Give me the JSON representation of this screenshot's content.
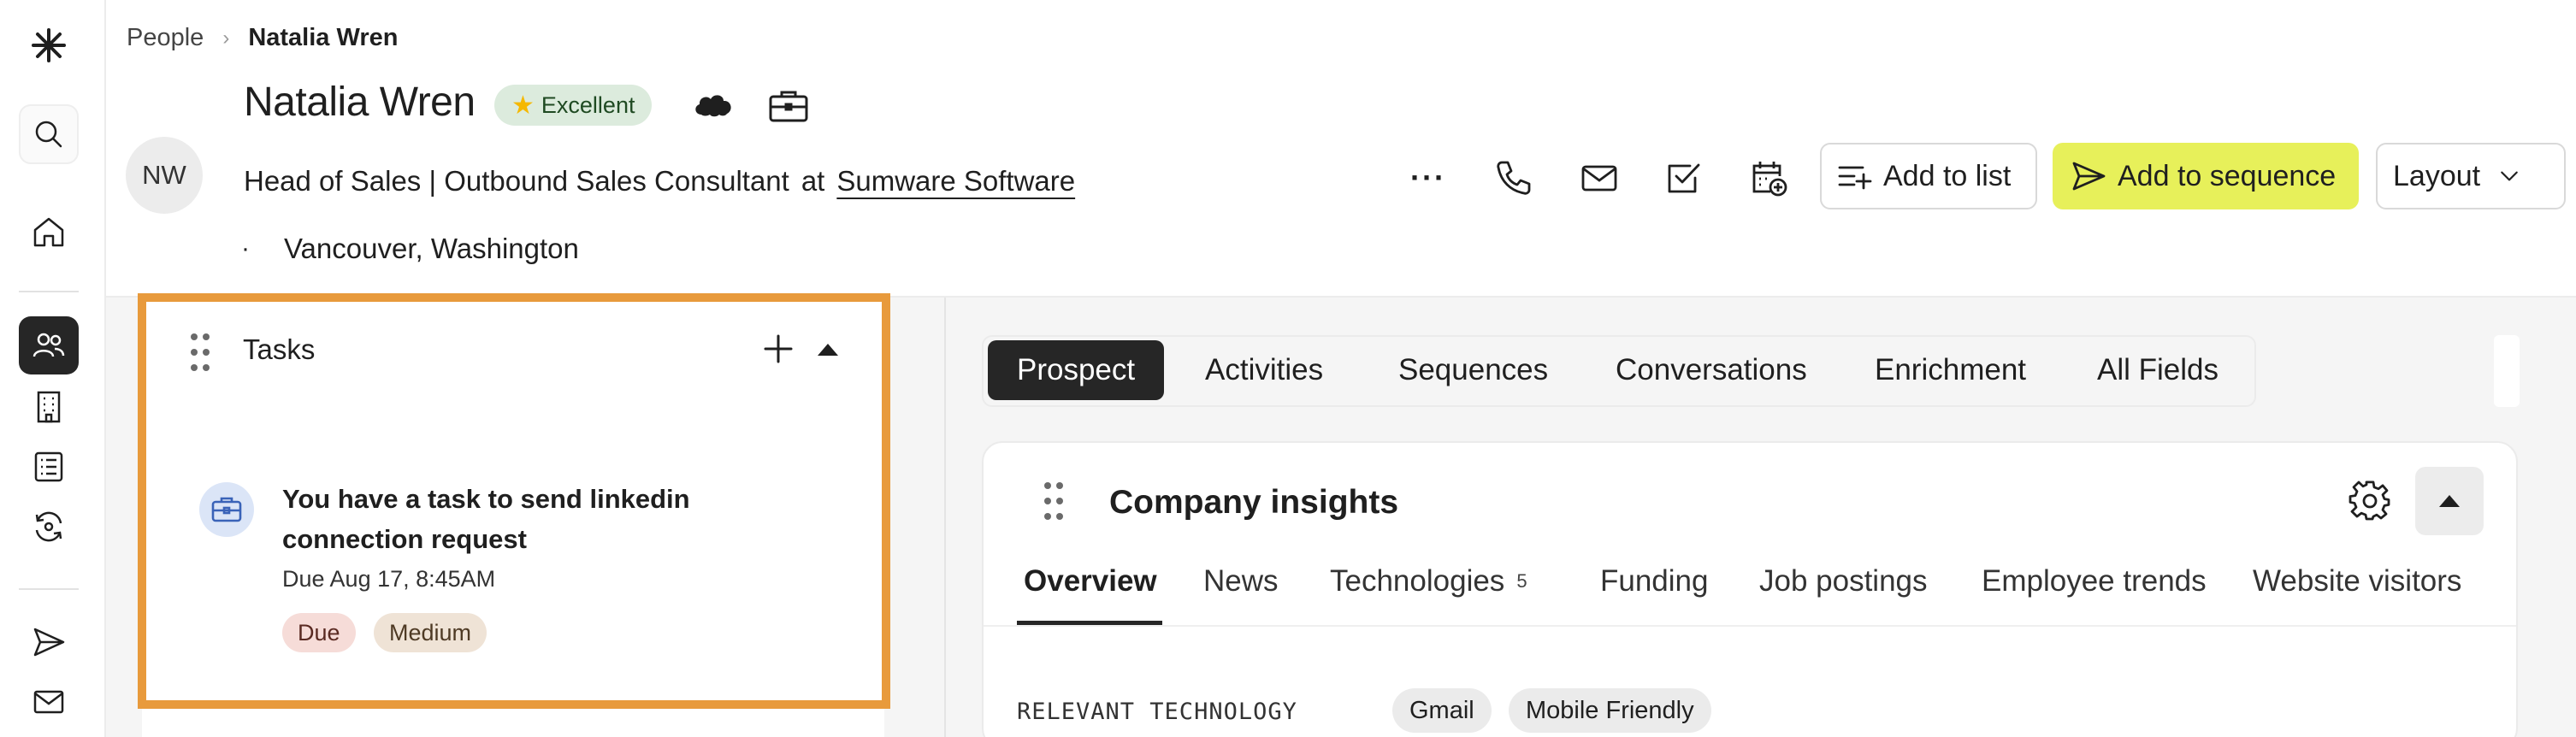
{
  "rail": {
    "items": [
      {
        "icon": "logo-asterisk-icon"
      },
      {
        "icon": "search-icon"
      },
      {
        "icon": "home-icon"
      },
      {
        "icon": "people-icon",
        "active": true
      },
      {
        "icon": "building-icon"
      },
      {
        "icon": "list-icon"
      },
      {
        "icon": "sync-icon"
      },
      {
        "icon": "send-icon"
      },
      {
        "icon": "mail-icon"
      }
    ]
  },
  "breadcrumb": {
    "parent": "People",
    "current": "Natalia Wren"
  },
  "person": {
    "name": "Natalia Wren",
    "rating": "Excellent",
    "initials": "NW",
    "title": "Head of Sales | Outbound Sales Consultant",
    "at": "at",
    "company": "Sumware Software",
    "location_bullet": "·",
    "location": "Vancouver, Washington"
  },
  "actions": {
    "more_label": "···",
    "add_to_list": "Add to list",
    "add_to_sequence": "Add to sequence",
    "layout": "Layout"
  },
  "tasks": {
    "title": "Tasks",
    "item": {
      "text": "You have a task to send linkedin connection request",
      "due": "Due Aug 17, 8:45AM",
      "tags": [
        "Due",
        "Medium"
      ]
    }
  },
  "tabs": [
    "Prospect",
    "Activities",
    "Sequences",
    "Conversations",
    "Enrichment",
    "All Fields"
  ],
  "company_insights": {
    "title": "Company insights",
    "subtabs": [
      "Overview",
      "News",
      "Technologies",
      "Funding",
      "Job postings",
      "Employee trends",
      "Website visitors"
    ],
    "technologies_count": "5",
    "relevant_label": "RELEVANT TECHNOLOGY",
    "chips": [
      "Gmail",
      "Mobile Friendly"
    ]
  },
  "colors": {
    "accent_yellow": "#e7f05a",
    "highlight_orange": "#e89a3c",
    "active_dark": "#262626",
    "rating_green": "#dcebdd"
  }
}
